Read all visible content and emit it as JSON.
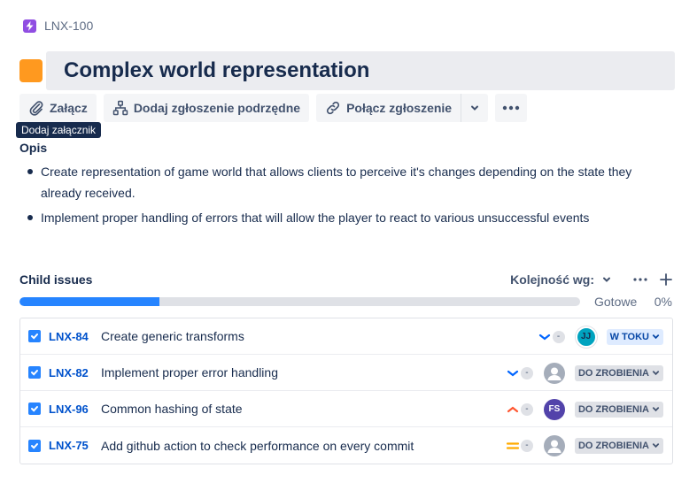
{
  "breadcrumb": {
    "parent_key": "LNX-100"
  },
  "issue": {
    "title": "Complex world representation"
  },
  "toolbar": {
    "attach_label": "Załącz",
    "add_child_label": "Dodaj zgłoszenie podrzędne",
    "link_issue_label": "Połącz zgłoszenie"
  },
  "tooltip": {
    "text": "Dodaj załącznik"
  },
  "description": {
    "heading": "Opis",
    "items": [
      "Create representation of game world that allows clients to perceive it's changes depending on the state they already received.",
      "Implement proper handling of errors that will allow the player to react to various unsuccessful events"
    ]
  },
  "child_issues": {
    "heading": "Child issues",
    "sort_label": "Kolejność wg:",
    "progress_label": "Gotowe",
    "progress_percent_text": "0%",
    "progress_fraction": 0.25,
    "items": [
      {
        "key": "LNX-84",
        "summary": "Create generic transforms",
        "priority": "low",
        "estimate": "-",
        "assignee_initials": "JJ",
        "status": "W TOKU"
      },
      {
        "key": "LNX-82",
        "summary": "Implement proper error handling",
        "priority": "low",
        "estimate": "-",
        "assignee_initials": "",
        "status": "DO ZROBIENIA"
      },
      {
        "key": "LNX-96",
        "summary": "Common hashing of state",
        "priority": "high",
        "estimate": "-",
        "assignee_initials": "FS",
        "status": "DO ZROBIENIA"
      },
      {
        "key": "LNX-75",
        "summary": "Add github action to check performance on every commit",
        "priority": "medium",
        "estimate": "-",
        "assignee_initials": "",
        "status": "DO ZROBIENIA"
      }
    ]
  },
  "colors": {
    "epic": "#904ee2",
    "task": "#ff991f",
    "progress": "#2684ff",
    "priority_low": "#0065ff",
    "priority_high": "#ff5630",
    "priority_medium": "#ffab00"
  },
  "icons": {
    "attach": "paperclip-icon",
    "add_child": "hierarchy-icon",
    "link": "link-icon",
    "more": "more-icon",
    "sort": "chevron-down-icon",
    "add": "plus-icon"
  }
}
